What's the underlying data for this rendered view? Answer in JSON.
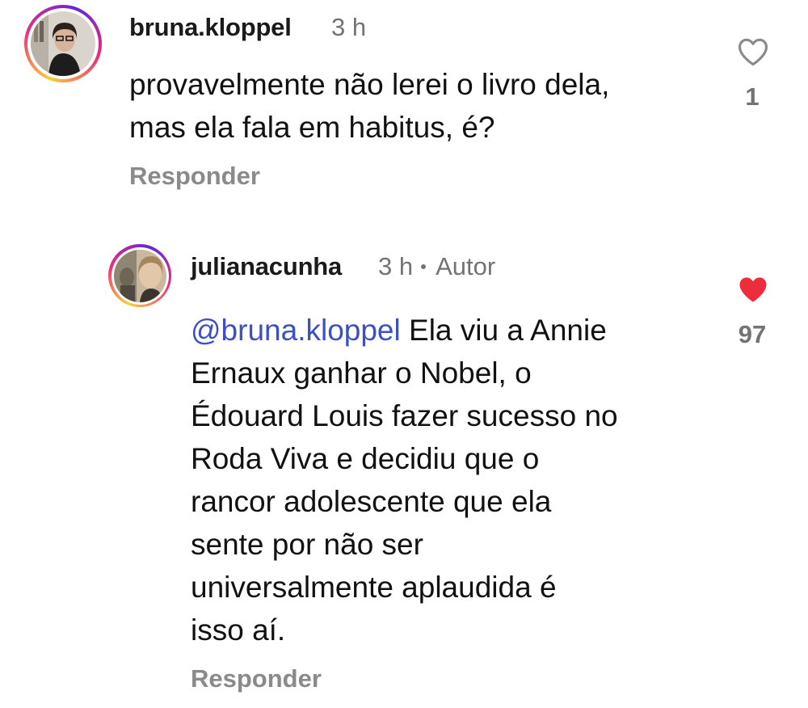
{
  "comments": [
    {
      "username": "bruna.kloppel",
      "time": "3 h",
      "badge": "",
      "text_lines": [
        "provavelmente não lerei o livro dela,",
        "mas ela fala em habitus, é?"
      ],
      "reply_label": "Responder",
      "like_count": "1",
      "liked": false,
      "avatar_icon": "profile-photo"
    },
    {
      "username": "julianacunha",
      "time": "3 h",
      "badge": "Autor",
      "mention": "@bruna.kloppel",
      "text_lines": [
        " Ela viu a Annie",
        "Ernaux ganhar o Nobel, o",
        "Édouard Louis fazer sucesso no",
        "Roda Viva e decidiu que o",
        "rancor adolescente que ela",
        "sente por não ser",
        "universalmente aplaudida é",
        "isso aí."
      ],
      "reply_label": "Responder",
      "like_count": "97",
      "liked": true,
      "avatar_icon": "profile-photo"
    }
  ],
  "colors": {
    "mention": "#3d4fc4",
    "liked_heart": "#ed2c3c",
    "secondary_text": "#737373",
    "story_ring": [
      "#f9ce34",
      "#ee2a7b",
      "#6228d7"
    ]
  }
}
